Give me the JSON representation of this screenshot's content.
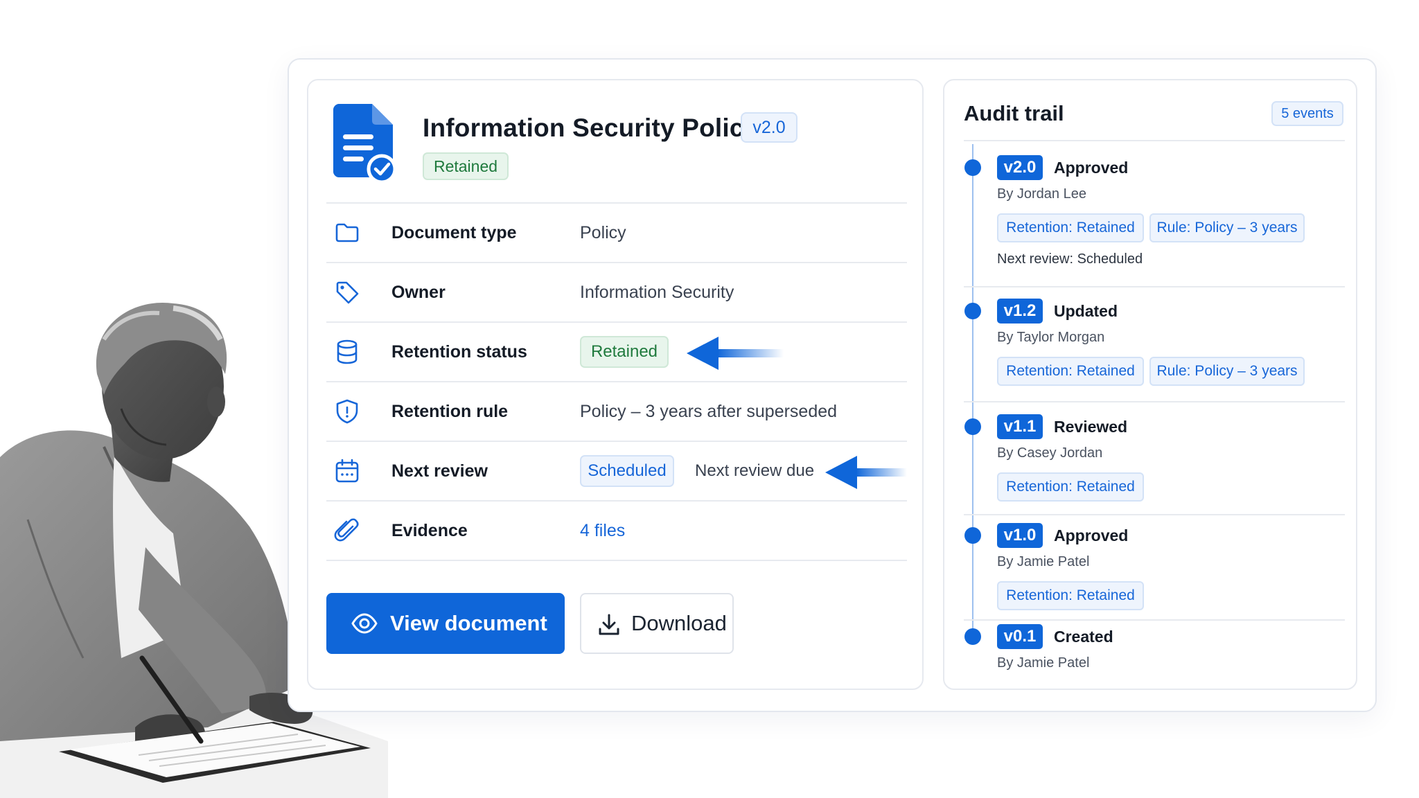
{
  "document": {
    "title": "Information Security Policy",
    "version": "v2.0",
    "status_badge": "Retained",
    "icon": "document-check-icon"
  },
  "details": [
    {
      "icon": "folder-icon",
      "label": "Document type",
      "value": "Policy"
    },
    {
      "icon": "tag-icon",
      "label": "Owner",
      "value": "Information Security"
    },
    {
      "icon": "database-icon",
      "label": "Retention status",
      "value": "Retained"
    },
    {
      "icon": "shield-icon",
      "label": "Retention rule",
      "value": "Policy – 3 years after superseded"
    },
    {
      "icon": "calendar-icon",
      "label": "Next review",
      "value": "Scheduled",
      "extra": "Next review due"
    },
    {
      "icon": "paperclip-icon",
      "label": "Evidence",
      "value": "4 files"
    }
  ],
  "actions": {
    "view_label": "View document",
    "view_icon": "eye-icon",
    "download_label": "Download",
    "download_icon": "download-icon"
  },
  "audit": {
    "title": "Audit trail",
    "count_label": "5 events",
    "events": [
      {
        "version": "v2.0",
        "action": "Approved",
        "by": "By Jordan Lee",
        "tags": [
          "Retention: Retained",
          "Rule: Policy – 3 years"
        ],
        "next_review": "Next review: Scheduled"
      },
      {
        "version": "v1.2",
        "action": "Updated",
        "by": "By Taylor Morgan",
        "tags": [
          "Retention: Retained",
          "Rule: Policy – 3 years"
        ]
      },
      {
        "version": "v1.1",
        "action": "Reviewed",
        "by": "By Casey Jordan",
        "tags": [
          "Retention: Retained"
        ]
      },
      {
        "version": "v1.0",
        "action": "Approved",
        "by": "By Jamie Patel",
        "tags": [
          "Retention: Retained"
        ]
      },
      {
        "version": "v0.1",
        "action": "Created",
        "by": "By Jamie Patel",
        "tags": []
      }
    ]
  },
  "colors": {
    "accent": "#0f66d9",
    "retained_green": "#1f7a3d",
    "retained_bg": "#e8f5ec",
    "chip_bg": "#eef4fd"
  }
}
